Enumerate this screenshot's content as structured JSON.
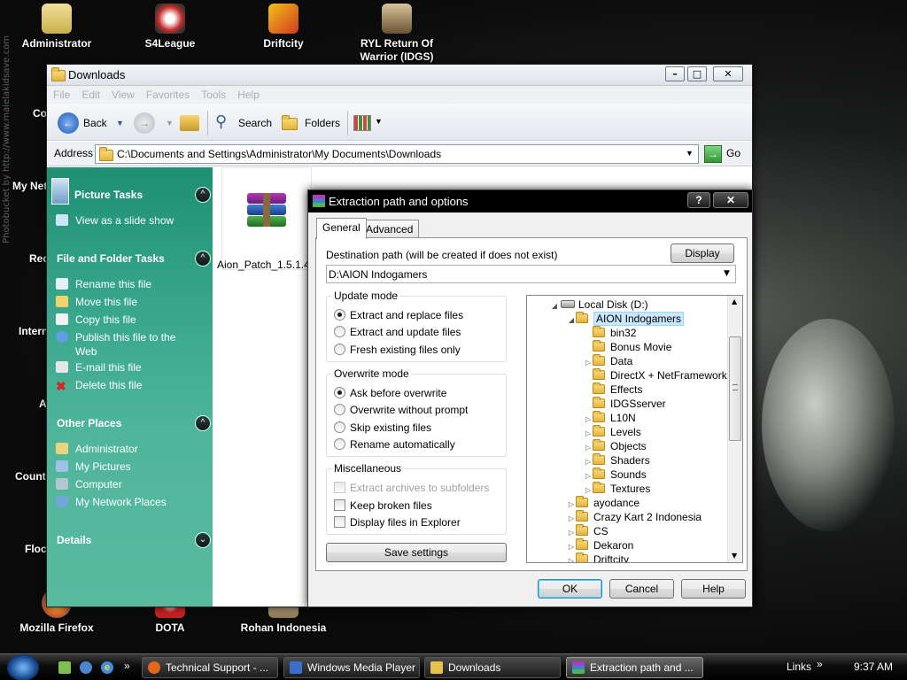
{
  "desktop": {
    "icons": [
      {
        "label": "Administrator",
        "color": "#d9c46a"
      },
      {
        "label": "S4League",
        "color": "#c42b2b"
      },
      {
        "label": "Driftcity",
        "color": "#d03a1e"
      },
      {
        "label": "RYL Return Of Warrior (IDGS)",
        "color": "#b79a62"
      },
      {
        "label": "Mozilla Firefox",
        "color": "#e2661c"
      },
      {
        "label": "DOTA",
        "color": "#c61f1f"
      },
      {
        "label": "Rohan Indonesia",
        "color": "#d8c6a0"
      }
    ],
    "peek_labels": [
      "Co",
      "My Net",
      "Rec",
      "Intern",
      "A",
      "Count",
      "Floc"
    ],
    "watermark": "Photobucket by http://www.malelakidsave.com"
  },
  "explorer": {
    "title": "Downloads",
    "menu": [
      "File",
      "Edit",
      "View",
      "Favorites",
      "Tools",
      "Help"
    ],
    "toolbar": {
      "back": "Back",
      "search": "Search",
      "folders": "Folders"
    },
    "address_label": "Address",
    "address_value": "C:\\Documents and Settings\\Administrator\\My Documents\\Downloads",
    "go_label": "Go",
    "picture_tasks": {
      "header": "Picture Tasks",
      "items": [
        "View as a slide show"
      ]
    },
    "file_folder_tasks": {
      "header": "File and Folder Tasks",
      "items": [
        "Rename this file",
        "Move this file",
        "Copy this file",
        "Publish this file to the Web",
        "E-mail this file",
        "Delete this file"
      ]
    },
    "other_places": {
      "header": "Other Places",
      "items": [
        "Administrator",
        "My Pictures",
        "Computer",
        "My Network Places"
      ]
    },
    "details": {
      "header": "Details"
    },
    "file": {
      "name": "Aion_Patch_1.5.1.4_"
    }
  },
  "dialog": {
    "title": "Extraction path and options",
    "tabs": [
      "General",
      "Advanced"
    ],
    "destination_label": "Destination path (will be created if does not exist)",
    "display_button": "Display",
    "destination_value": "D:\\AION Indogamers",
    "update_mode": {
      "caption": "Update mode",
      "options": [
        "Extract and replace files",
        "Extract and update files",
        "Fresh existing files only"
      ],
      "selected": 0
    },
    "overwrite_mode": {
      "caption": "Overwrite mode",
      "options": [
        "Ask before overwrite",
        "Overwrite without prompt",
        "Skip existing files",
        "Rename automatically"
      ],
      "selected": 0
    },
    "misc": {
      "caption": "Miscellaneous",
      "options": [
        "Extract archives to subfolders",
        "Keep broken files",
        "Display files in Explorer"
      ]
    },
    "save_button": "Save settings",
    "tree": [
      {
        "label": "Local Disk (D:)",
        "level": 0,
        "expander": "open"
      },
      {
        "label": "AION Indogamers",
        "level": 1,
        "expander": "open",
        "selected": true
      },
      {
        "label": "bin32",
        "level": 2,
        "expander": ""
      },
      {
        "label": "Bonus Movie",
        "level": 2,
        "expander": ""
      },
      {
        "label": "Data",
        "level": 2,
        "expander": "closed"
      },
      {
        "label": "DirectX + NetFramework",
        "level": 2,
        "expander": ""
      },
      {
        "label": "Effects",
        "level": 2,
        "expander": ""
      },
      {
        "label": "IDGSserver",
        "level": 2,
        "expander": ""
      },
      {
        "label": "L10N",
        "level": 2,
        "expander": "closed"
      },
      {
        "label": "Levels",
        "level": 2,
        "expander": "closed"
      },
      {
        "label": "Objects",
        "level": 2,
        "expander": "closed"
      },
      {
        "label": "Shaders",
        "level": 2,
        "expander": "closed"
      },
      {
        "label": "Sounds",
        "level": 2,
        "expander": "closed"
      },
      {
        "label": "Textures",
        "level": 2,
        "expander": "closed"
      },
      {
        "label": "ayodance",
        "level": 1,
        "expander": "closed"
      },
      {
        "label": "Crazy Kart 2 Indonesia",
        "level": 1,
        "expander": "closed"
      },
      {
        "label": "CS",
        "level": 1,
        "expander": "closed"
      },
      {
        "label": "Dekaron",
        "level": 1,
        "expander": "closed"
      },
      {
        "label": "Driftcity",
        "level": 1,
        "expander": "closed"
      }
    ],
    "ok_button": "OK",
    "cancel_button": "Cancel",
    "help_button": "Help"
  },
  "taskbar": {
    "buttons": [
      {
        "label": "Technical Support - ...",
        "color": "#e2661c"
      },
      {
        "label": "Windows Media Player",
        "color": "#3a6fd0"
      },
      {
        "label": "Downloads",
        "color": "#e8c04c"
      },
      {
        "label": "Extraction path and ...",
        "color": "#8b3fa0"
      }
    ],
    "links_label": "Links",
    "chevron": "»",
    "time": "9:37 AM"
  }
}
